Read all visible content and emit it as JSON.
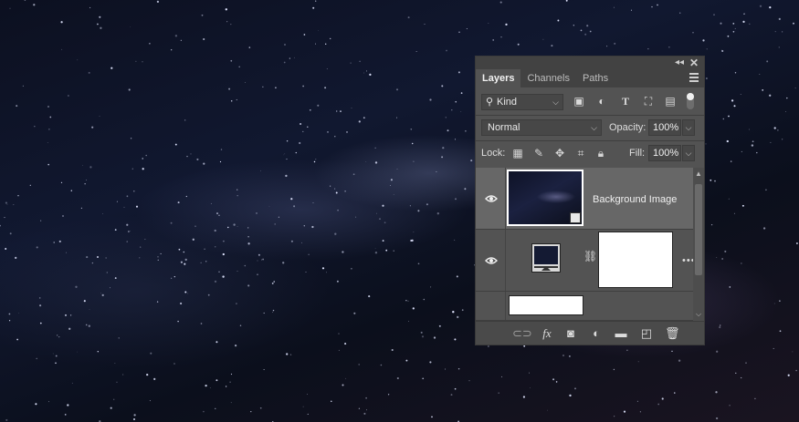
{
  "panel": {
    "tabs": [
      {
        "label": "Layers",
        "active": true
      },
      {
        "label": "Channels",
        "active": false
      },
      {
        "label": "Paths",
        "active": false
      }
    ],
    "filter": {
      "label": "Kind"
    },
    "blend_mode": "Normal",
    "opacity_label": "Opacity:",
    "opacity_value": "100%",
    "lock_label": "Lock:",
    "fill_label": "Fill:",
    "fill_value": "100%",
    "layers": [
      {
        "name": "Background Image",
        "visible": true,
        "selected": true,
        "type": "smart-object"
      },
      {
        "name": "",
        "visible": true,
        "selected": false,
        "type": "adjustment-levels"
      },
      {
        "name": "",
        "visible": false,
        "selected": false,
        "type": "fill"
      }
    ]
  },
  "colors": {
    "panel_bg": "#535353",
    "panel_header": "#424242",
    "selected_row": "#676767",
    "text": "#e6e6e6"
  },
  "icons": [
    "search-icon",
    "image-filter-icon",
    "adjustment-filter-icon",
    "type-filter-icon",
    "shape-filter-icon",
    "smart-object-filter-icon",
    "toggle-icon",
    "lock-pixels-icon",
    "brush-icon",
    "move-icon",
    "artboard-icon",
    "lock-icon",
    "eye-icon",
    "link-icon",
    "fx-icon",
    "mask-icon",
    "new-adjustment-icon",
    "folder-icon",
    "new-layer-icon",
    "trash-icon"
  ]
}
